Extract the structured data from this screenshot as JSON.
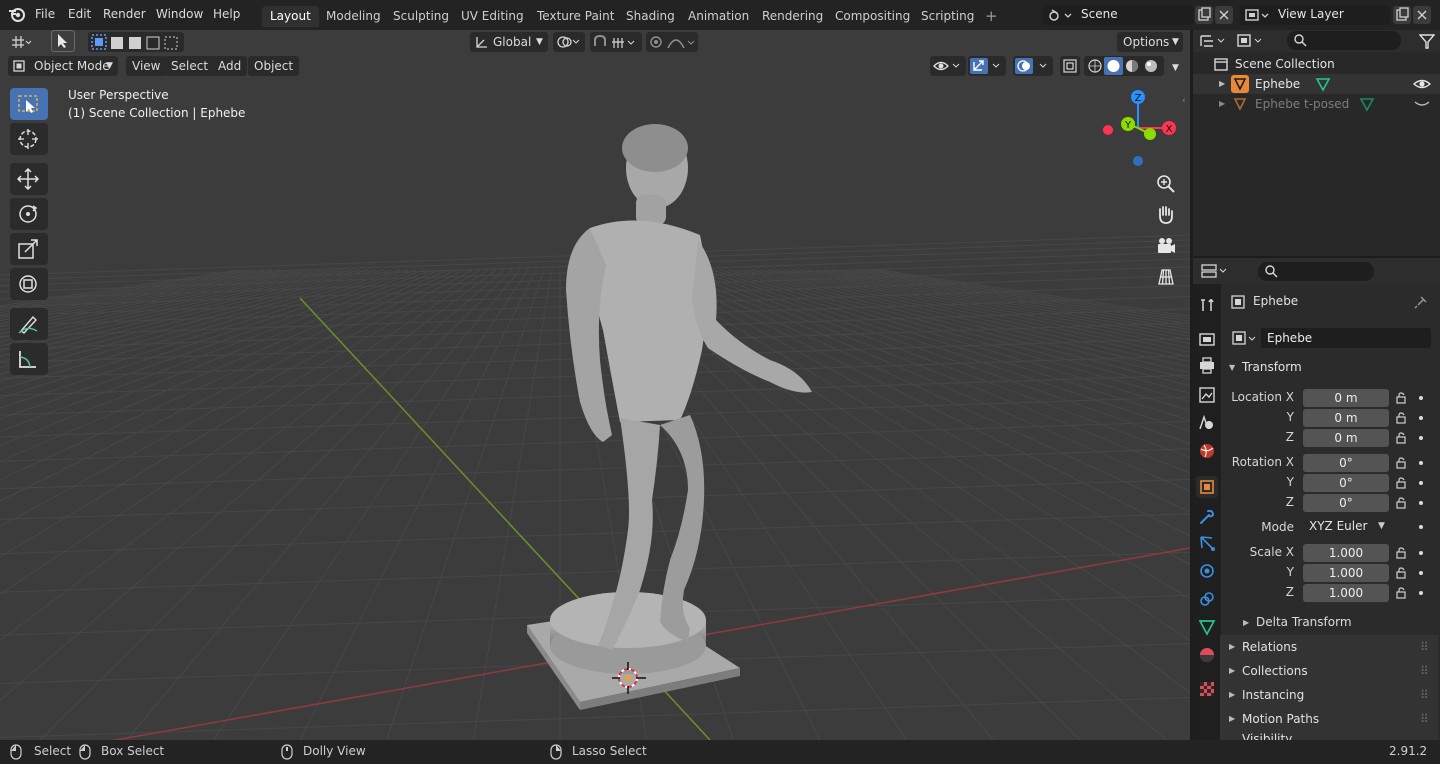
{
  "menu": [
    "File",
    "Edit",
    "Render",
    "Window",
    "Help"
  ],
  "workspaces": [
    {
      "label": "Layout",
      "active": true
    },
    {
      "label": "Modeling",
      "active": false
    },
    {
      "label": "Sculpting",
      "active": false
    },
    {
      "label": "UV Editing",
      "active": false
    },
    {
      "label": "Texture Paint",
      "active": false
    },
    {
      "label": "Shading",
      "active": false
    },
    {
      "label": "Animation",
      "active": false
    },
    {
      "label": "Rendering",
      "active": false
    },
    {
      "label": "Compositing",
      "active": false
    },
    {
      "label": "Scripting",
      "active": false
    }
  ],
  "add_workspace": "+",
  "scene": {
    "label": "Scene"
  },
  "view_layer": {
    "label": "View Layer"
  },
  "viewport": {
    "transform_orientation": "Global",
    "options": "Options",
    "mode": "Object Mode",
    "menus": [
      "View",
      "Select",
      "Add",
      "Object"
    ],
    "info_line1": "User Perspective",
    "info_line2": "(1) Scene Collection | Ephebe",
    "gizmo": {
      "z": "Z",
      "y": "Y",
      "x": "X"
    }
  },
  "outliner": {
    "root": "Scene Collection",
    "items": [
      {
        "label": "Ephebe",
        "dimmed": false
      },
      {
        "label": "Ephebe t-posed",
        "dimmed": true
      }
    ]
  },
  "properties": {
    "object_name": "Ephebe",
    "datablock_name": "Ephebe",
    "transform_title": "Transform",
    "location_label": "Location X",
    "rotation_label": "Rotation X",
    "scale_label": "Scale X",
    "y_label": "Y",
    "z_label": "Z",
    "location": [
      "0 m",
      "0 m",
      "0 m"
    ],
    "rotation": [
      "0°",
      "0°",
      "0°"
    ],
    "mode_label": "Mode",
    "mode_value": "XYZ Euler",
    "scale": [
      "1.000",
      "1.000",
      "1.000"
    ],
    "delta_transform": "Delta Transform",
    "panels": [
      "Relations",
      "Collections",
      "Instancing",
      "Motion Paths",
      "Visibility"
    ]
  },
  "statusbar": {
    "select": "Select",
    "box_select": "Box Select",
    "dolly_view": "Dolly View",
    "lasso_select": "Lasso Select",
    "version": "2.91.2"
  },
  "colors": {
    "accent_blue": "#4772b3",
    "axis_x": "#ff3352",
    "axis_y": "#8bdc00",
    "axis_z": "#2890ff",
    "object_orange": "#e8883a"
  }
}
